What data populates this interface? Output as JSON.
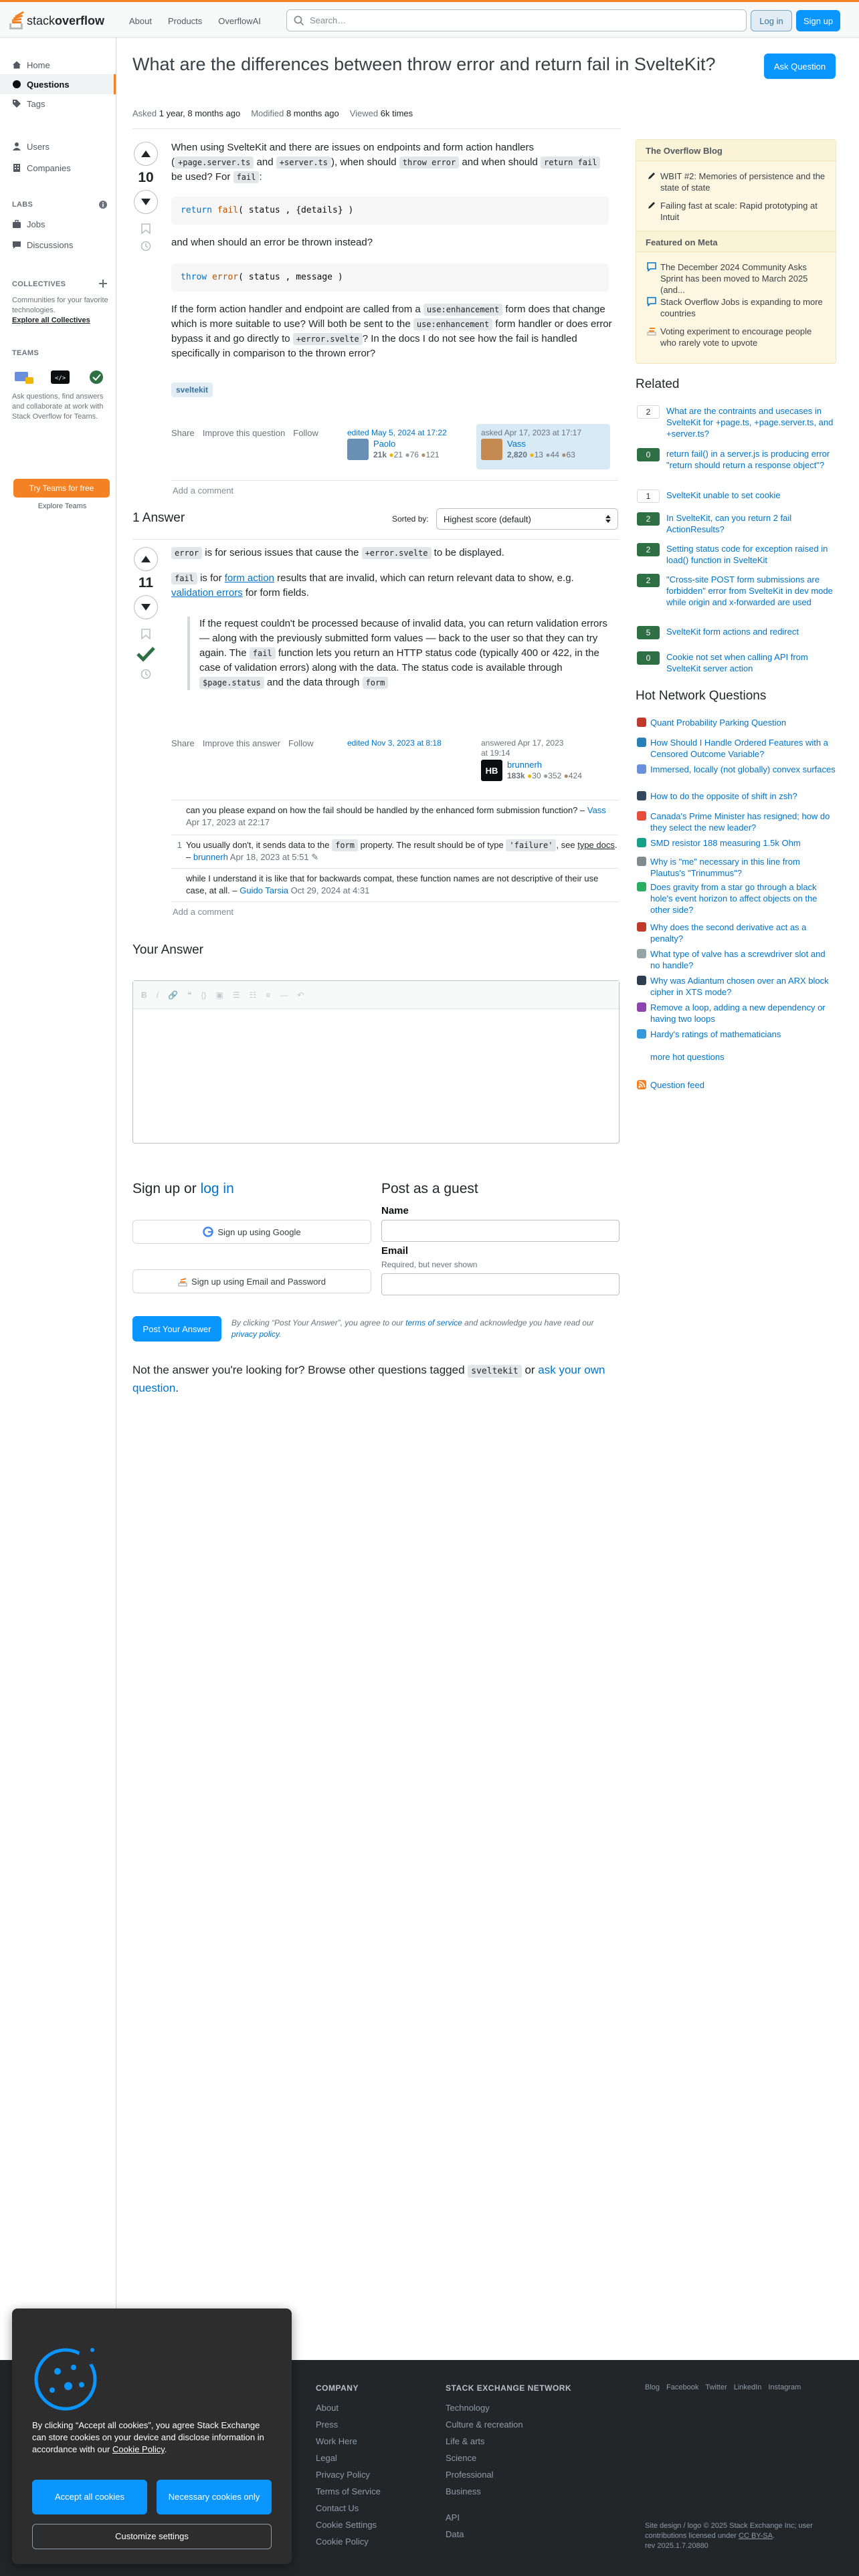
{
  "topbar": {
    "logo_stack": "stack",
    "logo_overflow": "overflow",
    "nav": [
      "About",
      "Products",
      "OverflowAI"
    ],
    "search_placeholder": "Search…",
    "login": "Log in",
    "signup": "Sign up"
  },
  "sidebar": {
    "home": "Home",
    "questions": "Questions",
    "tags": "Tags",
    "users": "Users",
    "companies": "Companies",
    "labs": "LABS",
    "jobs": "Jobs",
    "discussions": "Discussions",
    "collectives": "COLLECTIVES",
    "collectives_desc": "Communities for your favorite technologies.",
    "explore_collectives": "Explore all Collectives",
    "teams": "TEAMS",
    "teams_desc": "Ask questions, find answers and collaborate at work with Stack Overflow for Teams.",
    "teams_btn": "Try Teams for free",
    "explore_teams": "Explore Teams"
  },
  "question": {
    "title": "What are the differences between throw error and return fail in SvelteKit?",
    "ask_button": "Ask Question",
    "asked_label": "Asked",
    "asked_value": "1 year, 8 months ago",
    "modified_label": "Modified",
    "modified_value": "8 months ago",
    "viewed_label": "Viewed",
    "viewed_value": "6k times",
    "score": "10",
    "p1_a": "When using SvelteKit and there are issues on endpoints and form action handlers (",
    "p1_code1": "+page.server.ts",
    "p1_b": " and ",
    "p1_code2": "+server.ts",
    "p1_c": "), when should ",
    "p1_code3": "throw error",
    "p1_d": " and when should ",
    "p1_code4": "return fail",
    "p1_e": " be used? For ",
    "p1_code5": "fail",
    "p1_f": ":",
    "code1_kw": "return",
    "code1_fn": "fail",
    "code1_args": "( status , {details} )",
    "p2": "and when should an error be thrown instead?",
    "code2_kw": "throw",
    "code2_fn": "error",
    "code2_args": "( status ,  message )",
    "p3_a": "If the form action handler and endpoint are called from a ",
    "p3_code1": "use:enhancement",
    "p3_b": " form does that change which is more suitable to use? Will both be sent to the ",
    "p3_code2": "use:enhancement",
    "p3_c": " form handler or does error bypass it and go directly to ",
    "p3_code3": "+error.svelte",
    "p3_d": "? In the docs I do not see how the fail is handled specifically in comparison to the thrown error?",
    "tag": "sveltekit",
    "menu": [
      "Share",
      "Improve this question",
      "Follow"
    ],
    "edited_label": "edited May 5, 2024 at 17:22",
    "editor_name": "Paolo",
    "editor_rep": "21k",
    "editor_gold": "21",
    "editor_silver": "76",
    "editor_bronze": "121",
    "asked_card_label": "asked Apr 17, 2023 at 17:17",
    "asker_name": "Vass",
    "asker_rep": "2,820",
    "asker_gold": "13",
    "asker_silver": "44",
    "asker_bronze": "63",
    "add_comment": "Add a comment"
  },
  "answers": {
    "header": "1 Answer",
    "sorted_by": "Sorted by:",
    "sort_value": "Highest score (default)",
    "score": "11",
    "p1_code1": "error",
    "p1_a": " is for serious issues that cause the ",
    "p1_code2": "+error.svelte",
    "p1_b": " to be displayed.",
    "p2_code1": "fail",
    "p2_a": " is for ",
    "p2_link1": "form action",
    "p2_b": " results that are invalid, which can return relevant data to show, e.g. ",
    "p2_link2": "validation errors",
    "p2_c": " for form fields.",
    "quote_a": "If the request couldn't be processed because of invalid data, you can return validation errors — along with the previously submitted form values — back to the user so that they can try again. The ",
    "quote_code1": "fail",
    "quote_b": " function lets you return an HTTP status code (typically 400 or 422, in the case of validation errors) along with the data. The status code is available through ",
    "quote_code2": "$page.status",
    "quote_c": " and the data through ",
    "quote_code3": "form",
    "menu": [
      "Share",
      "Improve this answer",
      "Follow"
    ],
    "edited_label": "edited Nov 3, 2023 at 8:18",
    "answered_label": "answered Apr 17, 2023 at 19:14",
    "answerer_name": "brunnerh",
    "answerer_initials": "HB",
    "answerer_rep": "183k",
    "answerer_gold": "30",
    "answerer_silver": "352",
    "answerer_bronze": "424",
    "comments": [
      {
        "score": "",
        "text": "can you please expand on how the fail should be handled by the enhanced form submission function?",
        "user": "Vass",
        "date": "Apr 17, 2023 at 22:17"
      },
      {
        "score": "1",
        "text_a": "You usually don't, it sends data to the ",
        "code": "form",
        "text_b": " property. The result should be of type ",
        "code2": "'failure'",
        "text_c": ", see ",
        "link": "type docs",
        "text_d": ".",
        "user": "brunnerh",
        "date": "Apr 18, 2023 at 5:51"
      },
      {
        "score": "",
        "text": "while I understand it is like that for backwards compat, these function names are not descriptive of their use case, at all.",
        "user": "Guido Tarsia",
        "date": "Oct 29, 2024 at 4:31"
      }
    ],
    "add_comment": "Add a comment"
  },
  "your_answer": {
    "header": "Your Answer",
    "signup_header": "Sign up or",
    "login_link": "log in",
    "google_btn": "Sign up using Google",
    "email_btn": "Sign up using Email and Password",
    "guest_header": "Post as a guest",
    "name_label": "Name",
    "email_label": "Email",
    "email_note": "Required, but never shown",
    "post_btn": "Post Your Answer",
    "agree_a": "By clicking “Post Your Answer”, you agree to our ",
    "terms_link": "terms of service",
    "agree_b": " and acknowledge you have read our ",
    "privacy_link": "privacy policy",
    "agree_c": ".",
    "not_answer_a": "Not the answer you're looking for? Browse other questions tagged ",
    "not_answer_tag": "sveltekit",
    "not_answer_b": " or ",
    "ask_link": "ask your own question",
    "not_answer_c": "."
  },
  "right": {
    "blog_header": "The Overflow Blog",
    "blog_items": [
      "WBIT #2: Memories of persistence and the state of state",
      "Failing fast at scale: Rapid prototyping at Intuit"
    ],
    "meta_header": "Featured on Meta",
    "meta_items": [
      "The December 2024 Community Asks Sprint has been moved to March 2025 (and...",
      "Stack Overflow Jobs is expanding to more countries",
      "Voting experiment to encourage people who rarely vote to upvote"
    ],
    "related_header": "Related",
    "related": [
      {
        "score": "2",
        "accepted": false,
        "title": "What are the contraints and usecases in SvelteKit for +page.ts, +page.server.ts, and +server.ts?"
      },
      {
        "score": "0",
        "accepted": true,
        "title": "return fail() in a server.js is producing error \"return should return a response object\"?"
      },
      {
        "score": "1",
        "accepted": false,
        "title": "SvelteKit unable to set cookie"
      },
      {
        "score": "2",
        "accepted": true,
        "title": "In SvelteKit, can you return 2 fail ActionResults?"
      },
      {
        "score": "2",
        "accepted": true,
        "title": "Setting status code for exception raised in load() function in SvelteKit"
      },
      {
        "score": "2",
        "accepted": true,
        "title": "\"Cross-site POST form submissions are forbidden\" error from SvelteKit in dev mode while origin and x-forwarded are used"
      },
      {
        "score": "5",
        "accepted": true,
        "title": "SvelteKit form actions and redirect"
      },
      {
        "score": "0",
        "accepted": true,
        "title": "Cookie not set when calling API from SvelteKit server action"
      }
    ],
    "hnq_header": "Hot Network Questions",
    "hnq": [
      "Quant Probability Parking Question",
      "How Should I Handle Ordered Features with a Censored Outcome Variable?",
      "Immersed, locally (not globally) convex surfaces",
      "How to do the opposite of shift in zsh?",
      "Canada's Prime Minister has resigned; how do they select the new leader?",
      "SMD resistor 188 measuring 1.5k Ohm",
      "Why is \"me\" necessary in this line from Plautus's \"Trinummus\"?",
      "Does gravity from a star go through a black hole's event horizon to affect objects on the other side?",
      "Why does the second derivative act as a penalty?",
      "What type of valve has a screwdriver slot and no handle?",
      "Why was Adiantum chosen over an ARX block cipher in XTS mode?",
      "Remove a loop, adding a new dependency or having two loops",
      "Hardy's ratings of mathematicians"
    ],
    "more_hot": "more hot questions",
    "question_feed": "Question feed"
  },
  "footer": {
    "company_header": "COMPANY",
    "company": [
      "About",
      "Press",
      "Work Here",
      "Legal",
      "Privacy Policy",
      "Terms of Service",
      "Contact Us",
      "Cookie Settings",
      "Cookie Policy"
    ],
    "network_header": "STACK EXCHANGE NETWORK",
    "network": [
      "Technology",
      "Culture & recreation",
      "Life & arts",
      "Science",
      "Professional",
      "Business"
    ],
    "network2": [
      "API",
      "Data"
    ],
    "social": [
      "Blog",
      "Facebook",
      "Twitter",
      "LinkedIn",
      "Instagram"
    ],
    "copy_a": "Site design / logo © 2025 Stack Exchange Inc; user contributions licensed under ",
    "copy_link": "CC BY-SA",
    "copy_b": ".",
    "rev": "rev 2025.1.7.20880"
  },
  "cookie": {
    "text_a": "By clicking “Accept all cookies”, you agree Stack Exchange can store cookies on your device and disclose information in accordance with our ",
    "policy_link": "Cookie Policy",
    "text_b": ".",
    "accept": "Accept all cookies",
    "necessary": "Necessary cookies only",
    "customize": "Customize settings"
  },
  "colors": {
    "accent": "#f48225",
    "primary": "#0a95ff",
    "link": "#0074cc",
    "accepted": "#2f6f44"
  }
}
